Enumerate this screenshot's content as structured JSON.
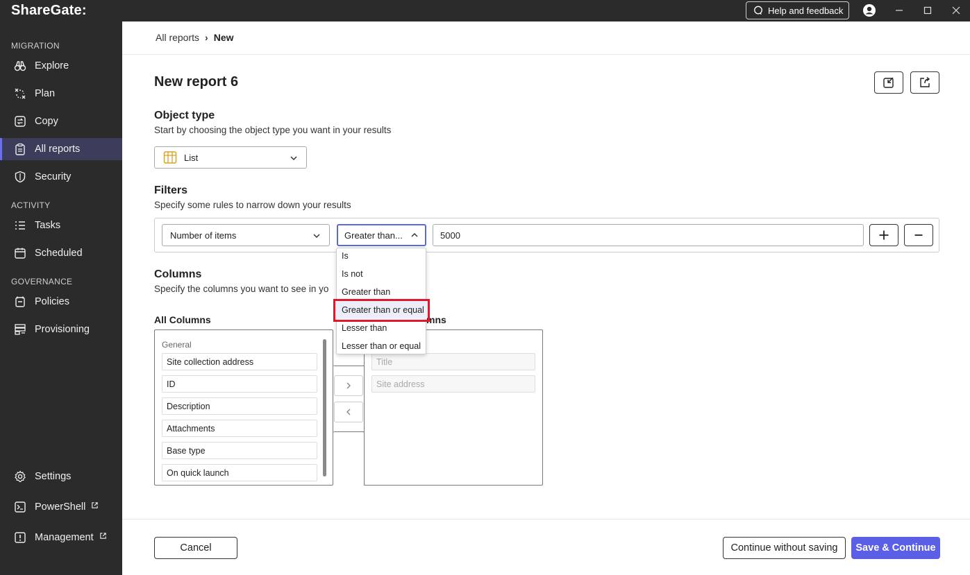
{
  "app": {
    "logo": "ShareGate:",
    "help_label": "Help and feedback"
  },
  "sidebar": {
    "sections": {
      "migration": "MIGRATION",
      "activity": "ACTIVITY",
      "governance": "GOVERNANCE"
    },
    "items": {
      "explore": "Explore",
      "plan": "Plan",
      "copy": "Copy",
      "all_reports": "All reports",
      "security": "Security",
      "tasks": "Tasks",
      "scheduled": "Scheduled",
      "policies": "Policies",
      "provisioning": "Provisioning",
      "settings": "Settings",
      "powershell": "PowerShell",
      "management": "Management"
    },
    "active": "All reports"
  },
  "breadcrumb": {
    "parent": "All reports",
    "separator": "›",
    "current": "New"
  },
  "page": {
    "title": "New report 6"
  },
  "object_type": {
    "heading": "Object type",
    "description": "Start by choosing the object type you want in your results",
    "selected": "List"
  },
  "filters": {
    "heading": "Filters",
    "description": "Specify some rules to narrow down your results",
    "field": "Number of items",
    "operator": "Greater than...",
    "value": "5000"
  },
  "operator_options": [
    "Is",
    "Is not",
    "Greater than",
    "Greater than or equal",
    "Lesser than",
    "Lesser than or equal"
  ],
  "operator_highlighted": "Greater than or equal",
  "columns": {
    "heading": "Columns",
    "description": "Specify the columns you want to see in yo",
    "all_label": "All Columns",
    "selected_label_visible": "mns",
    "group": "General",
    "all_items": [
      "Site collection address",
      "ID",
      "Description",
      "Attachments",
      "Base type",
      "On quick launch"
    ],
    "selected_items": [
      "Title",
      "Site address"
    ]
  },
  "footer": {
    "cancel": "Cancel",
    "continue_without_saving": "Continue without saving",
    "save_continue": "Save & Continue"
  },
  "colors": {
    "sidebar_bg": "#2b2b2b",
    "active_nav_bg": "#3b3d5a",
    "primary": "#5a5fe6",
    "highlight_box": "#e0182c"
  }
}
